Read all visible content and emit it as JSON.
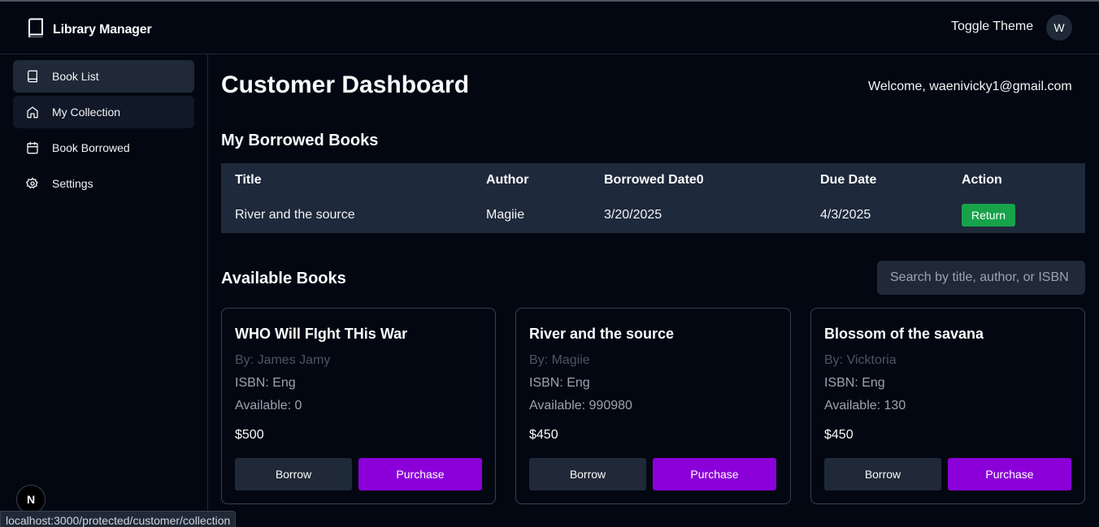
{
  "app": {
    "title": "Library Manager"
  },
  "header": {
    "toggle_theme": "Toggle Theme",
    "avatar_initial": "W"
  },
  "sidebar": {
    "items": [
      {
        "label": "Book List",
        "icon": "book-icon"
      },
      {
        "label": "My Collection",
        "icon": "home-icon"
      },
      {
        "label": "Book Borrowed",
        "icon": "calendar-icon"
      },
      {
        "label": "Settings",
        "icon": "gear-icon"
      }
    ]
  },
  "main": {
    "title": "Customer Dashboard",
    "welcome": "Welcome, waenivicky1@gmail.com",
    "borrowed": {
      "heading": "My Borrowed Books",
      "columns": [
        "Title",
        "Author",
        "Borrowed Date0",
        "Due Date",
        "Action"
      ],
      "rows": [
        {
          "title": "River and the source",
          "author": "Magiie",
          "borrowed": "3/20/2025",
          "due": "4/3/2025",
          "action": "Return"
        }
      ]
    },
    "available": {
      "heading": "Available Books",
      "search_placeholder": "Search by title, author, or ISBN",
      "books": [
        {
          "title": "WHO Will FIght THis War",
          "by": "By: James Jamy",
          "isbn": "ISBN: Eng",
          "available": "Available: 0",
          "price": "$500",
          "borrow": "Borrow",
          "purchase": "Purchase"
        },
        {
          "title": "River and the source",
          "by": "By: Magiie",
          "isbn": "ISBN: Eng",
          "available": "Available: 990980",
          "price": "$450",
          "borrow": "Borrow",
          "purchase": "Purchase"
        },
        {
          "title": "Blossom of the savana",
          "by": "By: Vicktoria",
          "isbn": "ISBN: Eng",
          "available": "Available: 130",
          "price": "$450",
          "borrow": "Borrow",
          "purchase": "Purchase"
        }
      ]
    }
  },
  "status_bar": {
    "url": "localhost:3000/protected/customer/collection"
  },
  "next_badge": "N",
  "colors": {
    "background": "#030712",
    "return": "#16a34a",
    "purchase": "#8b00d9",
    "panel": "#1e293b"
  }
}
